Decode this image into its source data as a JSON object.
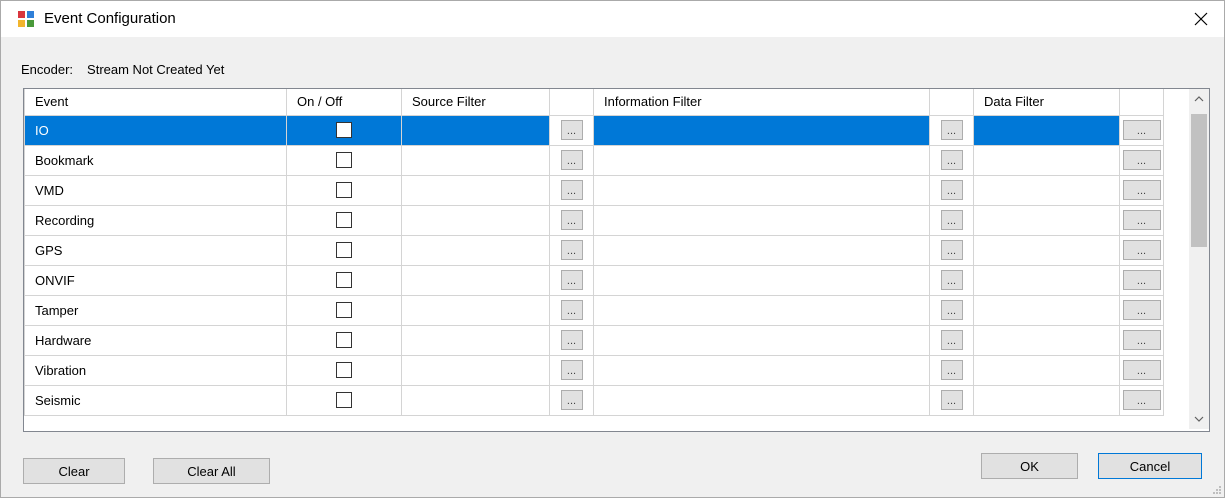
{
  "window": {
    "title": "Event Configuration"
  },
  "encoder": {
    "label": "Encoder:",
    "value": "Stream Not Created Yet"
  },
  "grid": {
    "columns": {
      "event": "Event",
      "onoff": "On / Off",
      "source": "Source Filter",
      "info": "Information Filter",
      "data": "Data Filter"
    },
    "ellipsis": "...",
    "rows": [
      {
        "event": "IO",
        "on": false,
        "selected": true
      },
      {
        "event": "Bookmark",
        "on": false
      },
      {
        "event": "VMD",
        "on": false
      },
      {
        "event": "Recording",
        "on": false
      },
      {
        "event": "GPS",
        "on": false
      },
      {
        "event": "ONVIF",
        "on": false
      },
      {
        "event": "Tamper",
        "on": false
      },
      {
        "event": "Hardware",
        "on": false
      },
      {
        "event": "Vibration",
        "on": false
      },
      {
        "event": "Seismic",
        "on": false
      }
    ]
  },
  "buttons": {
    "clear": "Clear",
    "clear_all": "Clear All",
    "ok": "OK",
    "cancel": "Cancel"
  },
  "colors": {
    "selection": "#0078d7",
    "window_bg": "#f0f0f0"
  }
}
